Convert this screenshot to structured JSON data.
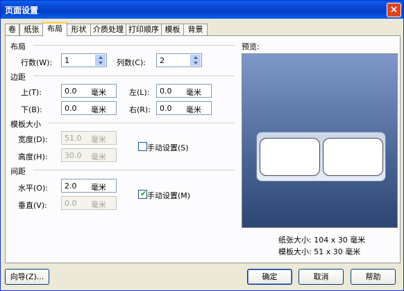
{
  "window": {
    "title": "页面设置",
    "close": "×"
  },
  "tabs": [
    {
      "label": "卷"
    },
    {
      "label": "纸张"
    },
    {
      "label": "布局"
    },
    {
      "label": "形状"
    },
    {
      "label": "介质处理"
    },
    {
      "label": "打印顺序"
    },
    {
      "label": "模板"
    },
    {
      "label": "背景"
    }
  ],
  "layout_group": {
    "title": "布局",
    "rows_label": "行数(W):",
    "rows_value": "1",
    "cols_label": "列数(C):",
    "cols_value": "2"
  },
  "margin_group": {
    "title": "边距",
    "top_label": "上(T):",
    "top_value": "0.0",
    "top_unit": "毫米",
    "left_label": "左(L):",
    "left_value": "0.0",
    "left_unit": "毫米",
    "bottom_label": "下(B):",
    "bottom_value": "0.0",
    "bottom_unit": "毫米",
    "right_label": "右(R):",
    "right_value": "0.0",
    "right_unit": "毫米"
  },
  "template_size_group": {
    "title": "模板大小",
    "width_label": "宽度(D):",
    "width_value": "51.0",
    "width_unit": "毫米",
    "height_label": "高度(H):",
    "height_value": "30.0",
    "height_unit": "毫米",
    "manual_label": "手动设置(S)",
    "manual_checked": false
  },
  "spacing_group": {
    "title": "间距",
    "horizontal_label": "水平(O):",
    "horizontal_value": "2.0",
    "horizontal_unit": "毫米",
    "vertical_label": "垂直(V):",
    "vertical_value": "0.0",
    "vertical_unit": "毫米",
    "manual_label": "手动设置(M)",
    "manual_checked": true,
    "check_glyph": "✔"
  },
  "preview": {
    "title": "预览:",
    "paper_size": "纸张大小: 104 x 30 毫米",
    "template_size": "模板大小: 51 x 30 毫米"
  },
  "buttons": {
    "wizard": "向导(Z)...",
    "ok": "确定",
    "cancel": "取消",
    "help": "帮助"
  },
  "colors": {
    "titlebar": "#0A5FE8",
    "dialog_bg": "#ECE9D8",
    "active_tab_accent": "#FFC83C",
    "preview_bg_top": "#7E98C9",
    "preview_bg_bottom": "#2C4573"
  }
}
